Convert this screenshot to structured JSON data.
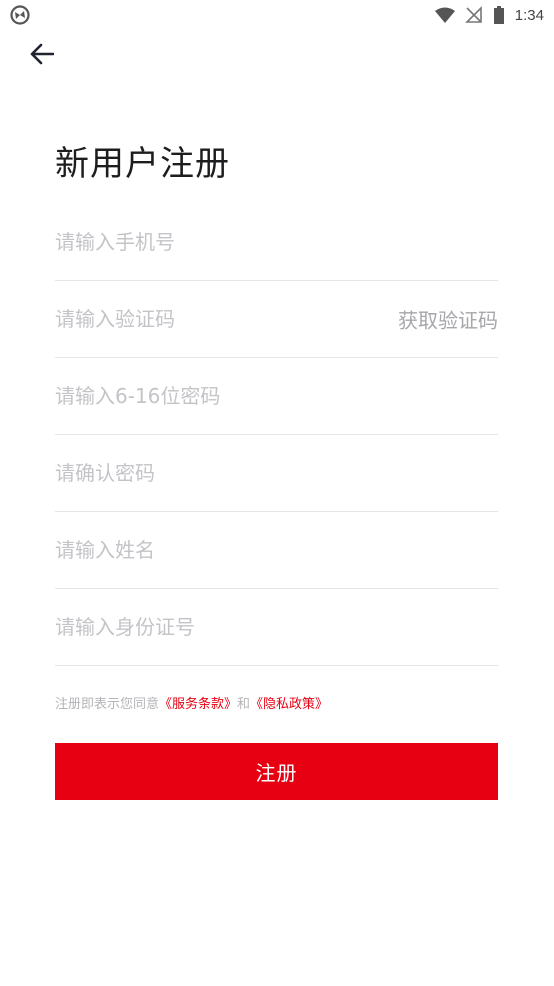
{
  "status_bar": {
    "time": "1:34",
    "icons": [
      "app-logo-icon",
      "wifi-icon",
      "signal-off-icon",
      "battery-icon"
    ]
  },
  "header": {
    "back_icon": "arrow-left-icon",
    "title": "新用户注册"
  },
  "form": {
    "phone_placeholder": "请输入手机号",
    "code_placeholder": "请输入验证码",
    "get_code_label": "获取验证码",
    "password_placeholder": "请输入6-16位密码",
    "confirm_placeholder": "请确认密码",
    "name_placeholder": "请输入姓名",
    "id_placeholder": "请输入身份证号"
  },
  "agreement": {
    "prefix": "注册即表示您同意",
    "terms": "《服务条款》",
    "conjunction": "和",
    "privacy": "《隐私政策》"
  },
  "submit_label": "注册",
  "colors": {
    "accent": "#e60012",
    "placeholder": "#c4c4c8",
    "divider": "#e5e5e5",
    "title": "#1d1d1f"
  }
}
